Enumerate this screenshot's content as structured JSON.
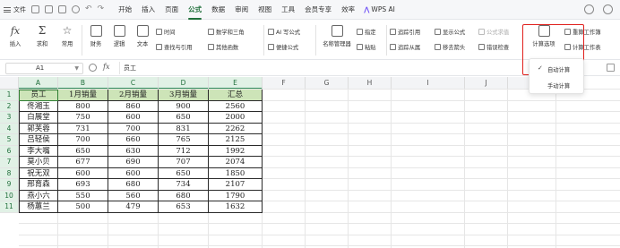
{
  "menubar": {
    "file_label": "文件",
    "tabs": [
      "开始",
      "插入",
      "页面",
      "公式",
      "数据",
      "审阅",
      "视图",
      "工具",
      "会员专享",
      "效率"
    ],
    "active_tab": "公式",
    "wps_ai": "WPS AI"
  },
  "ribbon": {
    "insert_fn": "插入",
    "sum": "求和",
    "common": "常用",
    "finance": "财务",
    "logic": "逻辑",
    "text": "文本",
    "datetime": "时间",
    "lookup": "查找与引用",
    "math": "数学和三角",
    "other_fn": "其他函数",
    "ai_formula": "AI 写公式",
    "easy_formula": "便捷公式",
    "name_manager": "名称管理器",
    "specify": "指定",
    "paste": "粘贴",
    "trace_precedents": "追踪引用",
    "trace_dependents": "追踪从属",
    "show_formulas": "显示公式",
    "remove_arrows": "移去箭头",
    "formula_eval": "公式求值",
    "error_check": "错误检查",
    "calc_options": "计算选项",
    "recalc_workbook": "重算工作簿",
    "calc_sheet": "计算工作表"
  },
  "dropdown": {
    "items": [
      "自动计算",
      "手动计算"
    ],
    "checked_index": 0
  },
  "formula_bar": {
    "cell_ref": "A1",
    "fx": "fx",
    "value": "员工"
  },
  "sheet": {
    "columns": [
      "A",
      "B",
      "C",
      "D",
      "E",
      "F",
      "G",
      "H",
      "I",
      "J",
      "K"
    ],
    "rows": [
      "1",
      "2",
      "3",
      "4",
      "5",
      "6",
      "7",
      "8",
      "9",
      "10",
      "11"
    ],
    "table": {
      "headers": [
        "员工",
        "1月销量",
        "2月销量",
        "3月销量",
        "汇总"
      ],
      "rows": [
        [
          "佟湘玉",
          "800",
          "860",
          "900",
          "2560"
        ],
        [
          "白展堂",
          "750",
          "600",
          "650",
          "2000"
        ],
        [
          "郭芙蓉",
          "731",
          "700",
          "831",
          "2262"
        ],
        [
          "吕轻侯",
          "700",
          "660",
          "765",
          "2125"
        ],
        [
          "李大嘴",
          "650",
          "630",
          "712",
          "1992"
        ],
        [
          "莫小贝",
          "677",
          "690",
          "707",
          "2074"
        ],
        [
          "祝无双",
          "600",
          "600",
          "650",
          "1850"
        ],
        [
          "邢育森",
          "693",
          "680",
          "734",
          "2107"
        ],
        [
          "燕小六",
          "550",
          "560",
          "680",
          "1790"
        ],
        [
          "杨蕙兰",
          "500",
          "479",
          "653",
          "1632"
        ]
      ]
    }
  },
  "colors": {
    "accent": "#1f6f3a",
    "header_fill": "#cde4b8",
    "highlight": "#e0201c"
  }
}
